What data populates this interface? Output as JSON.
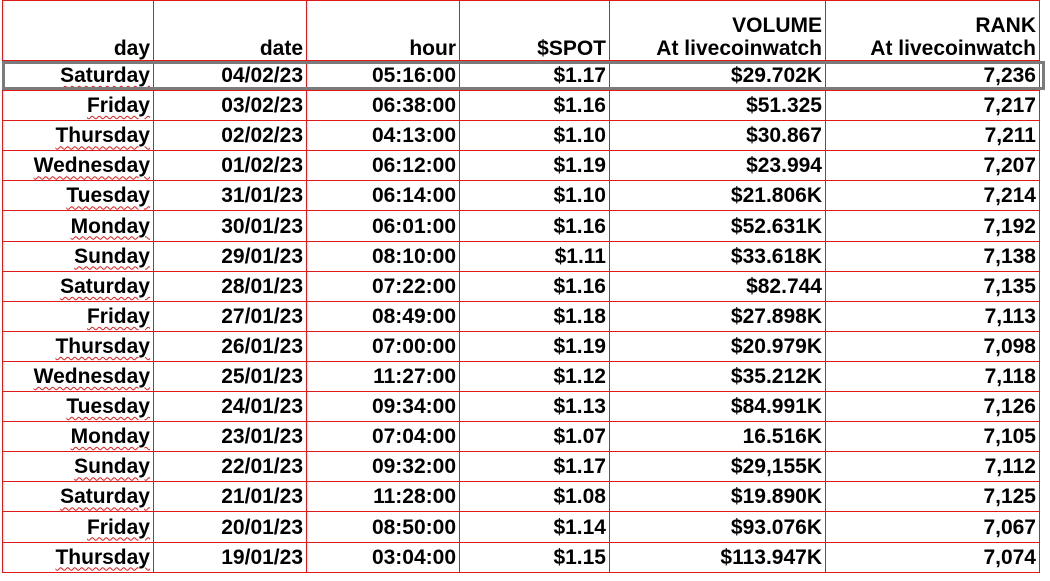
{
  "headers": {
    "day": {
      "l1": "",
      "l2": "day"
    },
    "date": {
      "l1": "",
      "l2": "date"
    },
    "hour": {
      "l1": "",
      "l2": "hour"
    },
    "spot": {
      "l1": "",
      "l2": "$SPOT"
    },
    "volume": {
      "l1": "VOLUME",
      "l2": "At livecoinwatch"
    },
    "rank": {
      "l1": "RANK",
      "l2": "At livecoinwatch"
    }
  },
  "rows": [
    {
      "day": "Saturday",
      "date": "04/02/23",
      "hour": "05:16:00",
      "spot": "$1.17",
      "volume": "$29.702K",
      "rank": "7,236"
    },
    {
      "day": "Friday",
      "date": "03/02/23",
      "hour": "06:38:00",
      "spot": "$1.16",
      "volume": "$51.325",
      "rank": "7,217"
    },
    {
      "day": "Thursday",
      "date": "02/02/23",
      "hour": "04:13:00",
      "spot": "$1.10",
      "volume": "$30.867",
      "rank": "7,211"
    },
    {
      "day": "Wednesday",
      "date": "01/02/23",
      "hour": "06:12:00",
      "spot": "$1.19",
      "volume": "$23.994",
      "rank": "7,207"
    },
    {
      "day": "Tuesday",
      "date": "31/01/23",
      "hour": "06:14:00",
      "spot": "$1.10",
      "volume": "$21.806K",
      "rank": "7,214"
    },
    {
      "day": "Monday",
      "date": "30/01/23",
      "hour": "06:01:00",
      "spot": "$1.16",
      "volume": "$52.631K",
      "rank": "7,192"
    },
    {
      "day": "Sunday",
      "date": "29/01/23",
      "hour": "08:10:00",
      "spot": "$1.11",
      "volume": "$33.618K",
      "rank": "7,138"
    },
    {
      "day": "Saturday",
      "date": "28/01/23",
      "hour": "07:22:00",
      "spot": "$1.16",
      "volume": "$82.744",
      "rank": "7,135"
    },
    {
      "day": "Friday",
      "date": "27/01/23",
      "hour": "08:49:00",
      "spot": "$1.18",
      "volume": "$27.898K",
      "rank": "7,113"
    },
    {
      "day": "Thursday",
      "date": "26/01/23",
      "hour": "07:00:00",
      "spot": "$1.19",
      "volume": "$20.979K",
      "rank": "7,098"
    },
    {
      "day": "Wednesday",
      "date": "25/01/23",
      "hour": "11:27:00",
      "spot": "$1.12",
      "volume": "$35.212K",
      "rank": "7,118"
    },
    {
      "day": "Tuesday",
      "date": "24/01/23",
      "hour": "09:34:00",
      "spot": "$1.13",
      "volume": "$84.991K",
      "rank": "7,126"
    },
    {
      "day": "Monday",
      "date": "23/01/23",
      "hour": "07:04:00",
      "spot": "$1.07",
      "volume": "16.516K",
      "rank": "7,105"
    },
    {
      "day": "Sunday",
      "date": "22/01/23",
      "hour": "09:32:00",
      "spot": "$1.17",
      "volume": "$29,155K",
      "rank": "7,112"
    },
    {
      "day": "Saturday",
      "date": "21/01/23",
      "hour": "11:28:00",
      "spot": "$1.08",
      "volume": "$19.890K",
      "rank": "7,125"
    },
    {
      "day": "Friday",
      "date": "20/01/23",
      "hour": "08:50:00",
      "spot": "$1.14",
      "volume": "$93.076K",
      "rank": "7,067"
    },
    {
      "day": "Thursday",
      "date": "19/01/23",
      "hour": "03:04:00",
      "spot": "$1.15",
      "volume": "$113.947K",
      "rank": "7,074"
    }
  ],
  "colors": {
    "grid": "#e01a1a",
    "selection": "#7b7b7b"
  }
}
